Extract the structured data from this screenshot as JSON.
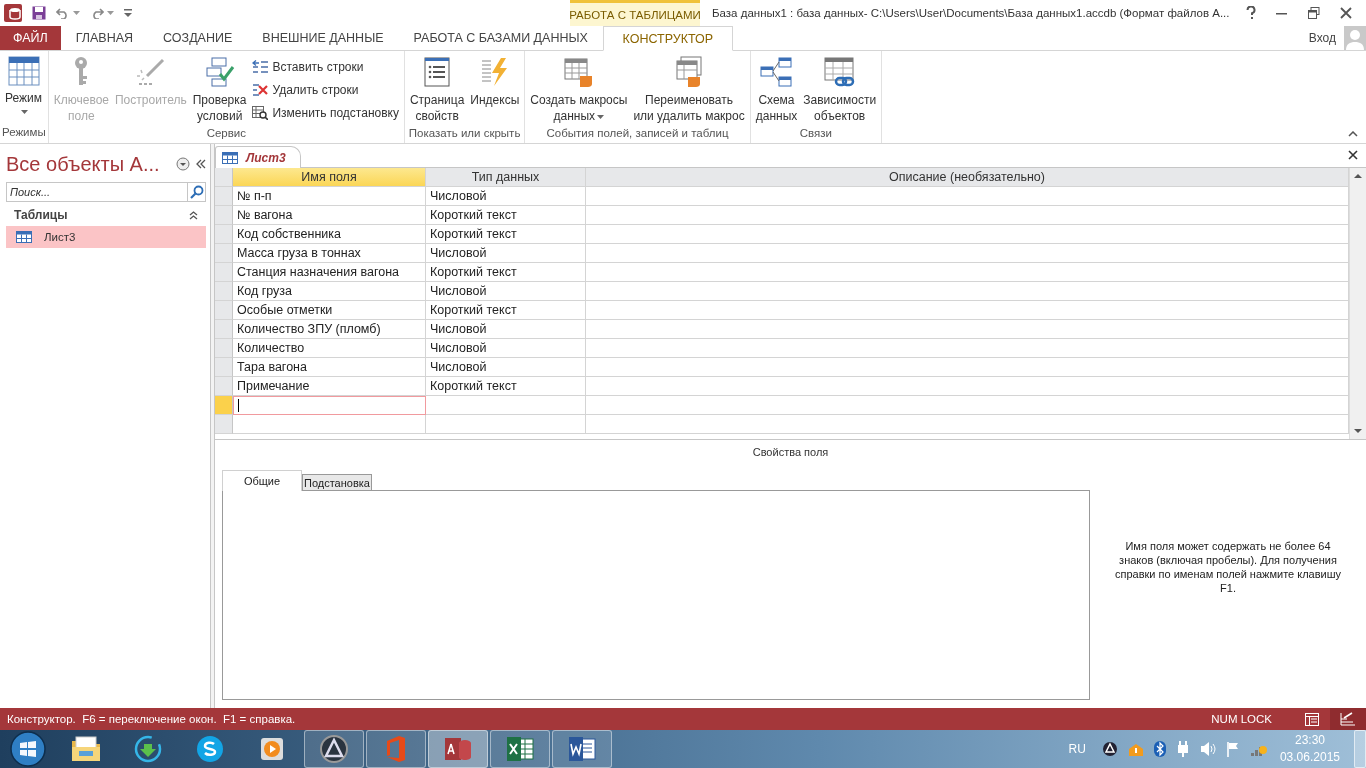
{
  "window": {
    "context_tab": "РАБОТА С ТАБЛИЦАМИ",
    "title": "База данных1 : база данных- C:\\Users\\User\\Documents\\База данных1.accdb (Формат файлов А...",
    "signin": "Вход"
  },
  "ribbon_tabs": [
    {
      "label": "ФАЙЛ",
      "kind": "file",
      "selected": false
    },
    {
      "label": "ГЛАВНАЯ",
      "kind": "tab",
      "selected": false
    },
    {
      "label": "СОЗДАНИЕ",
      "kind": "tab",
      "selected": false
    },
    {
      "label": "ВНЕШНИЕ ДАННЫЕ",
      "kind": "tab",
      "selected": false
    },
    {
      "label": "РАБОТА С БАЗАМИ ДАННЫХ",
      "kind": "tab",
      "selected": false
    },
    {
      "label": "КОНСТРУКТОР",
      "kind": "tab",
      "selected": true
    }
  ],
  "ribbon_groups": [
    {
      "label": "Режимы",
      "buttons": [
        {
          "kind": "large",
          "label": "Режим",
          "dropdown": true,
          "disabled": false
        }
      ]
    },
    {
      "label": "Сервис",
      "buttons": [
        {
          "kind": "large",
          "label": "Ключевое\nполе",
          "dropdown": false,
          "disabled": true
        },
        {
          "kind": "large",
          "label": "Построитель",
          "dropdown": false,
          "disabled": true
        },
        {
          "kind": "large",
          "label": "Проверка\nусловий",
          "dropdown": false,
          "disabled": false
        },
        {
          "kind": "small",
          "label": "Вставить строки",
          "dropdown": false,
          "disabled": false
        },
        {
          "kind": "small",
          "label": "Удалить строки",
          "dropdown": false,
          "disabled": false
        },
        {
          "kind": "small",
          "label": "Изменить подстановку",
          "dropdown": false,
          "disabled": false
        }
      ]
    },
    {
      "label": "Показать или скрыть",
      "buttons": [
        {
          "kind": "large",
          "label": "Страница\nсвойств",
          "dropdown": false,
          "disabled": false
        },
        {
          "kind": "large",
          "label": "Индексы",
          "dropdown": false,
          "disabled": false
        }
      ]
    },
    {
      "label": "События полей, записей и таблиц",
      "buttons": [
        {
          "kind": "large",
          "label": "Создать макросы\nданных",
          "dropdown": true,
          "disabled": false
        },
        {
          "kind": "large",
          "label": "Переименовать\nили удалить макрос",
          "dropdown": false,
          "disabled": false
        }
      ]
    },
    {
      "label": "Связи",
      "buttons": [
        {
          "kind": "large",
          "label": "Схема\nданных",
          "dropdown": false,
          "disabled": false
        },
        {
          "kind": "large",
          "label": "Зависимости\nобъектов",
          "dropdown": false,
          "disabled": false
        }
      ]
    }
  ],
  "navigation": {
    "title": "Все объекты А...",
    "search": {
      "placeholder": "Поиск..."
    },
    "section": {
      "label": "Таблицы",
      "expanded": true
    },
    "items": [
      {
        "label": "Лист3",
        "selected": true
      }
    ]
  },
  "document_tab": {
    "label": "Лист3",
    "selected": true
  },
  "table": {
    "columns": [
      "Имя поля",
      "Тип данных",
      "Описание (необязательно)"
    ],
    "rows": [
      {
        "name": "№ п-п",
        "type": "Числовой",
        "selected": false
      },
      {
        "name": "№ вагона",
        "type": "Короткий текст",
        "selected": false
      },
      {
        "name": "Код собственника",
        "type": "Короткий текст",
        "selected": false
      },
      {
        "name": "Масса груза в тоннах",
        "type": "Числовой",
        "selected": false
      },
      {
        "name": "Станция назначения вагона",
        "type": "Короткий текст",
        "selected": false
      },
      {
        "name": "Код груза",
        "type": "Числовой",
        "selected": false
      },
      {
        "name": "Особые отметки",
        "type": "Короткий текст",
        "selected": false
      },
      {
        "name": "Количество ЗПУ (пломб)",
        "type": "Числовой",
        "selected": false
      },
      {
        "name": "Количество",
        "type": "Числовой",
        "selected": false
      },
      {
        "name": "Тара вагона",
        "type": "Числовой",
        "selected": false
      },
      {
        "name": "Примечание",
        "type": "Короткий текст",
        "selected": false
      }
    ],
    "new_row": {
      "selected": true
    }
  },
  "field_properties": {
    "title": "Свойства поля",
    "tabs": [
      {
        "label": "Общие",
        "selected": true
      },
      {
        "label": "Подстановка",
        "selected": false
      }
    ],
    "help": "Имя поля может содержать не более 64 знаков (включая пробелы). Для получения справки по именам полей нажмите клавишу F1."
  },
  "status_bar": {
    "text": "Конструктор.  F6 = переключение окон.  F1 = справка.",
    "num_lock": "NUM LOCK",
    "views": [
      {
        "selected": false
      },
      {
        "selected": true
      }
    ]
  },
  "taskbar": {
    "apps": [
      {
        "running": false,
        "selected": false
      },
      {
        "running": false,
        "selected": false
      },
      {
        "running": false,
        "selected": false
      },
      {
        "running": false,
        "selected": false
      },
      {
        "running": true,
        "selected": false
      },
      {
        "running": true,
        "selected": false
      },
      {
        "running": true,
        "selected": true
      },
      {
        "running": true,
        "selected": false
      },
      {
        "running": true,
        "selected": false
      }
    ],
    "language": "RU",
    "time": "23:30",
    "date": "03.06.2015"
  }
}
